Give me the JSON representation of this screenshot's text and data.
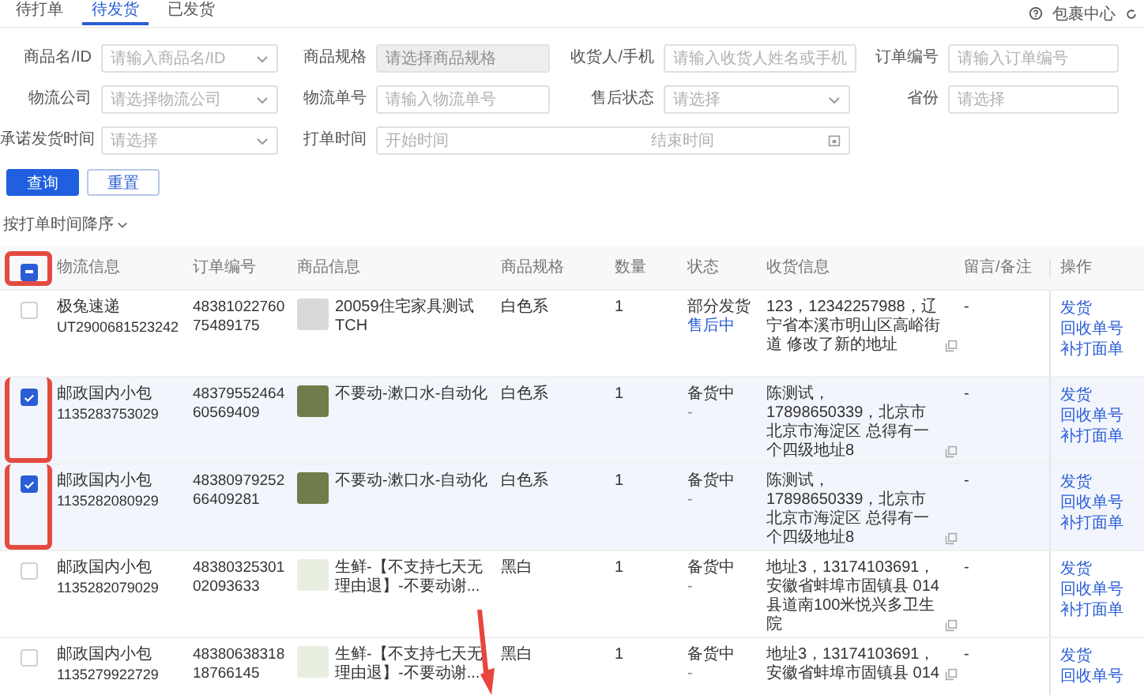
{
  "tabs": [
    {
      "label": "待打单",
      "selected": false
    },
    {
      "label": "待发货",
      "selected": true
    },
    {
      "label": "已发货",
      "selected": false
    }
  ],
  "parcel_center": "包裹中心",
  "filters": [
    {
      "label": "商品名/ID",
      "placeholder": "请输入商品名/ID",
      "kind": "select",
      "disabled": false
    },
    {
      "label": "商品规格",
      "placeholder": "请选择商品规格",
      "kind": "input",
      "disabled": true
    },
    {
      "label": "收货人/手机",
      "placeholder": "请输入收货人姓名或手机",
      "kind": "input",
      "disabled": false
    },
    {
      "label": "订单编号",
      "placeholder": "请输入订单编号",
      "kind": "input",
      "disabled": false
    },
    {
      "label": "物流公司",
      "placeholder": "请选择物流公司",
      "kind": "select",
      "disabled": false
    },
    {
      "label": "物流单号",
      "placeholder": "请输入物流单号",
      "kind": "input",
      "disabled": false
    },
    {
      "label": "售后状态",
      "placeholder": "请选择",
      "kind": "select",
      "disabled": false
    },
    {
      "label": "省份",
      "placeholder": "请选择",
      "kind": "input",
      "disabled": false
    },
    {
      "label": "承诺发货时间",
      "placeholder": "请选择",
      "kind": "select",
      "disabled": false
    },
    {
      "label": "打单时间",
      "placeholder": "开始时间",
      "end_placeholder": "结束时间",
      "kind": "daterange",
      "disabled": false
    }
  ],
  "buttons": [
    {
      "label": "查询",
      "kind": "primary"
    },
    {
      "label": "重置",
      "kind": "plain"
    }
  ],
  "sort": "按打单时间降序",
  "table": {
    "header_checkbox": {
      "indeterminate": true,
      "highlighted": true
    },
    "columns": [
      "物流信息",
      "订单编号",
      "商品信息",
      "商品规格",
      "数量",
      "状态",
      "收货信息",
      "留言/备注",
      "操作"
    ],
    "rows": [
      {
        "selected": false,
        "highlighted": false,
        "carrier": "极兔速递",
        "tracking": "UT2900681523242",
        "order_no": "4838102276075489175",
        "product": "20059住宅家具测试TCH",
        "spec": "白色系",
        "qty": "1",
        "status": "部分发货",
        "after_sale": "售后中",
        "address": "123，12342257988，辽宁省本溪市明山区高峪街道 修改了新的地址",
        "remark": "-",
        "actions": [
          "发货",
          "回收单号",
          "补打面单"
        ]
      },
      {
        "selected": true,
        "highlighted": true,
        "carrier": "邮政国内小包",
        "tracking": "1135283753029",
        "order_no": "4837955246460569409",
        "product": "不要动-漱口水-自动化",
        "spec": "白色系",
        "qty": "1",
        "status": "备货中",
        "after_sale": "-",
        "address": "陈测试，17898650339，北京市北京市海淀区 总得有一个四级地址8",
        "remark": "-",
        "actions": [
          "发货",
          "回收单号",
          "补打面单"
        ]
      },
      {
        "selected": true,
        "highlighted": true,
        "carrier": "邮政国内小包",
        "tracking": "1135282080929",
        "order_no": "4838097925266409281",
        "product": "不要动-漱口水-自动化",
        "spec": "白色系",
        "qty": "1",
        "status": "备货中",
        "after_sale": "-",
        "address": "陈测试，17898650339，北京市北京市海淀区 总得有一个四级地址8",
        "remark": "-",
        "actions": [
          "发货",
          "回收单号",
          "补打面单"
        ]
      },
      {
        "selected": false,
        "highlighted": false,
        "carrier": "邮政国内小包",
        "tracking": "1135282079029",
        "order_no": "4838032530102093633",
        "product": "生鲜-【不支持七天无理由退】-不要动谢...",
        "spec": "黑白",
        "qty": "1",
        "status": "备货中",
        "after_sale": "-",
        "address": "地址3，13174103691，安徽省蚌埠市固镇县 014 县道南100米悦兴多卫生院",
        "remark": "-",
        "actions": [
          "发货",
          "回收单号",
          "补打面单"
        ]
      },
      {
        "selected": false,
        "highlighted": false,
        "carrier": "邮政国内小包",
        "tracking": "1135279922729",
        "order_no": "4838063831818766145",
        "product": "生鲜-【不支持七天无理由退】-不要动谢...",
        "spec": "黑白",
        "qty": "1",
        "status": "备货中",
        "after_sale": "-",
        "address": "地址3，13174103691，安徽省蚌埠市固镇县 014",
        "remark": "-",
        "actions": [
          "发货",
          "回收单号"
        ]
      }
    ]
  }
}
